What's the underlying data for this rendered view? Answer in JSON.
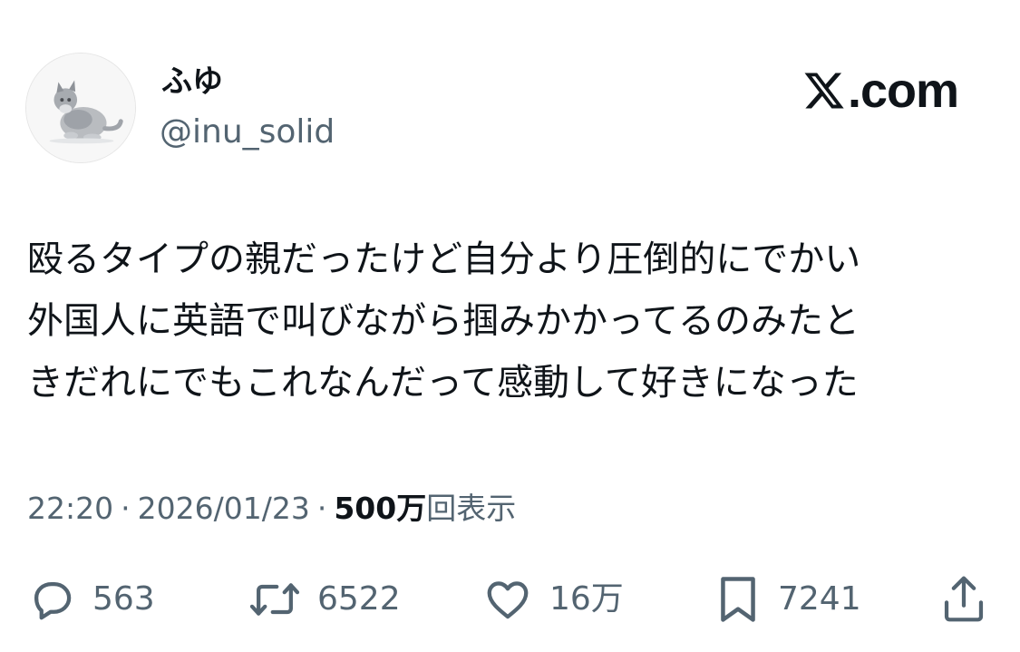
{
  "author": {
    "display_name": "ふゆ",
    "handle": "@inu_solid",
    "avatar_icon": "cat-avatar-icon"
  },
  "brand": {
    "logo_icon": "x-logo-icon",
    "text": ".com"
  },
  "tweet": {
    "lines": [
      "殴るタイプの親だったけど自分より圧倒的にでかい",
      "外国人に英語で叫びながら掴みかかってるのみたと",
      "きだれにでもこれなんだって感動して好きになった"
    ]
  },
  "meta": {
    "time": "22:20",
    "separator": "·",
    "date": "2026/01/23",
    "views_count": "500万",
    "views_label": "回表示"
  },
  "actions": {
    "reply": {
      "icon": "reply-bubble-icon",
      "count": "563"
    },
    "repost": {
      "icon": "repost-icon",
      "count": "6522"
    },
    "like": {
      "icon": "heart-icon",
      "count": "16万"
    },
    "bookmark": {
      "icon": "bookmark-icon",
      "count": "7241"
    },
    "share": {
      "icon": "share-icon"
    }
  },
  "colors": {
    "text_primary": "#0f1419",
    "text_secondary": "#536471",
    "background": "#ffffff"
  }
}
